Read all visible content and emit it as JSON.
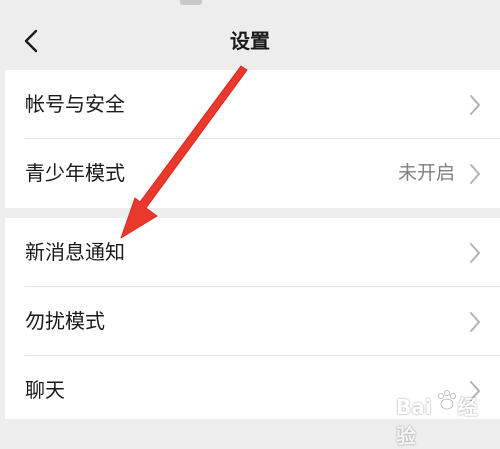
{
  "nav": {
    "title": "设置",
    "back_icon": "chevron-left-icon"
  },
  "groups": [
    {
      "items": [
        {
          "label": "帐号与安全",
          "value": ""
        },
        {
          "label": "青少年模式",
          "value": "未开启"
        }
      ]
    },
    {
      "items": [
        {
          "label": "新消息通知",
          "value": ""
        },
        {
          "label": "勿扰模式",
          "value": ""
        },
        {
          "label": "聊天",
          "value": ""
        }
      ]
    }
  ],
  "annotation": {
    "arrow_color": "#e8392c",
    "arrow_icon": "red-arrow-icon"
  },
  "watermark": {
    "text": "Bai",
    "text2": "经验",
    "paw_icon": "paw-icon"
  },
  "colors": {
    "background": "#ededed",
    "surface": "#ffffff",
    "text": "#1a1a1a",
    "secondary_text": "#808080",
    "chevron": "#b2b2b2"
  }
}
